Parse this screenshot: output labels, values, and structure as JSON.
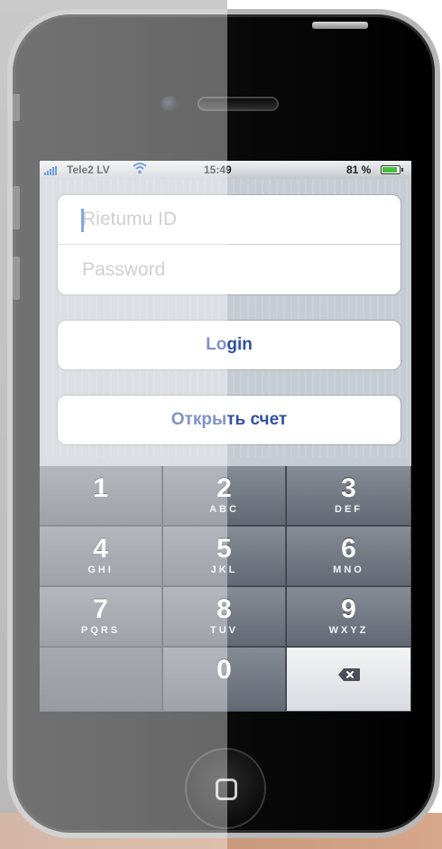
{
  "status_bar": {
    "carrier": "Tele2 LV",
    "time": "15:49",
    "battery": "81 %"
  },
  "login_form": {
    "id_placeholder": "Rietumu ID",
    "password_placeholder": "Password",
    "login_label": "Login",
    "open_account_label": "Открыть счет"
  },
  "keypad": {
    "keys": [
      {
        "num": "1",
        "letters": ""
      },
      {
        "num": "2",
        "letters": "ABC"
      },
      {
        "num": "3",
        "letters": "DEF"
      },
      {
        "num": "4",
        "letters": "GHI"
      },
      {
        "num": "5",
        "letters": "JKL"
      },
      {
        "num": "6",
        "letters": "MNO"
      },
      {
        "num": "7",
        "letters": "PQRS"
      },
      {
        "num": "8",
        "letters": "TUV"
      },
      {
        "num": "9",
        "letters": "WXYZ"
      },
      {
        "num": "0",
        "letters": ""
      }
    ],
    "delete_icon": "backspace-icon"
  },
  "colors": {
    "button_text": "#2f4fa0",
    "keypad_key": "#6f7580",
    "wifi": "#1e66c9",
    "battery_fill": "#42c03a"
  }
}
